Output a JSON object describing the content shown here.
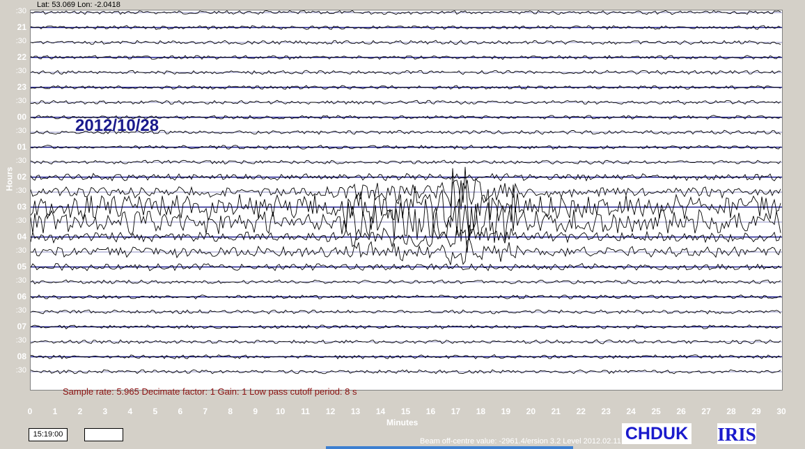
{
  "header": {
    "coordinates": "Lat: 53.069 Lon: -2.0418"
  },
  "axes": {
    "y_label": "Hours",
    "x_label": "Minutes",
    "x_ticks": [
      "0",
      "1",
      "2",
      "3",
      "4",
      "5",
      "6",
      "7",
      "8",
      "9",
      "10",
      "11",
      "12",
      "13",
      "14",
      "15",
      "16",
      "17",
      "18",
      "19",
      "20",
      "21",
      "22",
      "23",
      "24",
      "25",
      "26",
      "27",
      "28",
      "29",
      "30"
    ],
    "y_rows": [
      ":30",
      "21",
      ":30",
      "22",
      ":30",
      "23",
      ":30",
      "00",
      ":30",
      "01",
      ":30",
      "02",
      ":30",
      "03",
      ":30",
      "04",
      ":30",
      "05",
      ":30",
      "06",
      ":30",
      "07",
      ":30",
      "08",
      ":30"
    ]
  },
  "plot": {
    "date": "2012/10/28",
    "info": "Sample rate: 5.965  Decimate factor: 1  Gain: 1  Low pass cutoff period: 8 s",
    "trace_color": "#000000",
    "baseline_color": "#1a1a8c"
  },
  "footer": {
    "time_value": "15:19:00",
    "blank_value": "",
    "beam_text": "Beam off-centre value: -2961.4/ersion 3.2 Level 2012.02.11",
    "station": "CHDUK",
    "logo": "IRIS"
  }
}
